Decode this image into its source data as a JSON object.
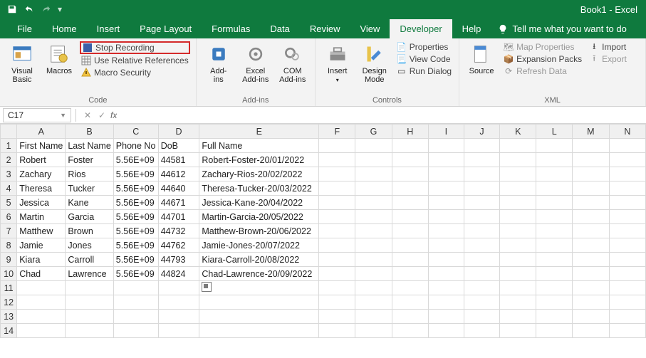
{
  "titlebar": {
    "title": "Book1  -  Excel"
  },
  "tabs": {
    "items": [
      "File",
      "Home",
      "Insert",
      "Page Layout",
      "Formulas",
      "Data",
      "Review",
      "View",
      "Developer",
      "Help"
    ],
    "active": "Developer",
    "tell_me": "Tell me what you want to do"
  },
  "ribbon": {
    "code": {
      "visual_basic": "Visual\nBasic",
      "macros": "Macros",
      "stop_recording": "Stop Recording",
      "use_relative": "Use Relative References",
      "macro_security": "Macro Security",
      "label": "Code"
    },
    "addins": {
      "addins": "Add-\nins",
      "excel_addins": "Excel\nAdd-ins",
      "com_addins": "COM\nAdd-ins",
      "label": "Add-ins"
    },
    "controls": {
      "insert": "Insert",
      "design_mode": "Design\nMode",
      "properties": "Properties",
      "view_code": "View Code",
      "run_dialog": "Run Dialog",
      "label": "Controls"
    },
    "xml": {
      "source": "Source",
      "map_properties": "Map Properties",
      "expansion_packs": "Expansion Packs",
      "refresh_data": "Refresh Data",
      "import": "Import",
      "export": "Export",
      "label": "XML"
    }
  },
  "formula_bar": {
    "namebox": "C17",
    "fx": "fx",
    "value": ""
  },
  "sheet": {
    "columns": [
      "A",
      "B",
      "C",
      "D",
      "E",
      "F",
      "G",
      "H",
      "I",
      "J",
      "K",
      "L",
      "M",
      "N"
    ],
    "headers": {
      "A": "First Name",
      "B": "Last Name",
      "C": "Phone No",
      "D": "DoB",
      "E": "Full Name"
    },
    "rows": [
      {
        "n": 1,
        "A": "First Name",
        "B": "Last Name",
        "C": "Phone No",
        "D": "DoB",
        "E": "Full Name"
      },
      {
        "n": 2,
        "A": "Robert",
        "B": "Foster",
        "C": "5.56E+09",
        "D": "44581",
        "E": "Robert-Foster-20/01/2022"
      },
      {
        "n": 3,
        "A": "Zachary",
        "B": "Rios",
        "C": "5.56E+09",
        "D": "44612",
        "E": "Zachary-Rios-20/02/2022"
      },
      {
        "n": 4,
        "A": "Theresa",
        "B": "Tucker",
        "C": "5.56E+09",
        "D": "44640",
        "E": "Theresa-Tucker-20/03/2022"
      },
      {
        "n": 5,
        "A": "Jessica",
        "B": "Kane",
        "C": "5.56E+09",
        "D": "44671",
        "E": "Jessica-Kane-20/04/2022"
      },
      {
        "n": 6,
        "A": "Martin",
        "B": "Garcia",
        "C": "5.56E+09",
        "D": "44701",
        "E": "Martin-Garcia-20/05/2022"
      },
      {
        "n": 7,
        "A": "Matthew",
        "B": "Brown",
        "C": "5.56E+09",
        "D": "44732",
        "E": "Matthew-Brown-20/06/2022"
      },
      {
        "n": 8,
        "A": "Jamie",
        "B": "Jones",
        "C": "5.56E+09",
        "D": "44762",
        "E": "Jamie-Jones-20/07/2022"
      },
      {
        "n": 9,
        "A": "Kiara",
        "B": "Carroll",
        "C": "5.56E+09",
        "D": "44793",
        "E": "Kiara-Carroll-20/08/2022"
      },
      {
        "n": 10,
        "A": "Chad",
        "B": "Lawrence",
        "C": "5.56E+09",
        "D": "44824",
        "E": "Chad-Lawrence-20/09/2022"
      },
      {
        "n": 11
      },
      {
        "n": 12
      },
      {
        "n": 13
      },
      {
        "n": 14
      }
    ]
  }
}
